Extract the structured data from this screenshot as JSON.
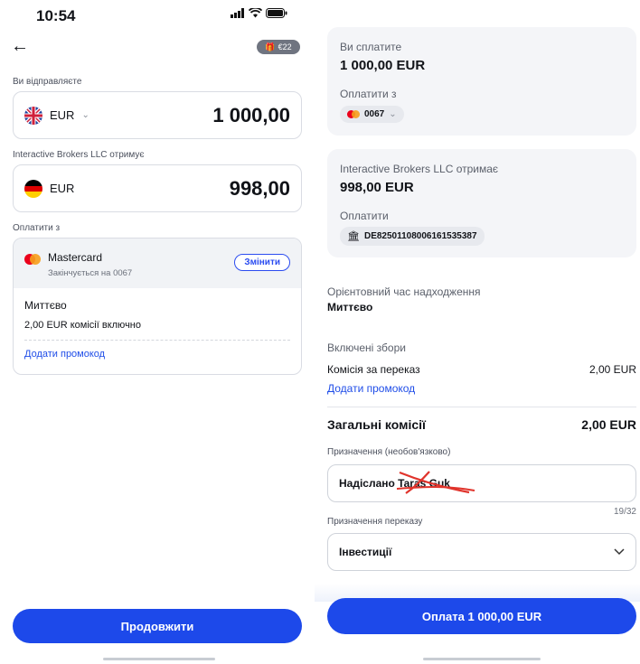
{
  "left": {
    "status_time": "10:54",
    "gift_badge": "€22",
    "send_label": "Ви відправляєте",
    "send_currency": "EUR",
    "send_amount": "1 000,00",
    "recipient_label": "Interactive Brokers LLC отримує",
    "recv_currency": "EUR",
    "recv_amount": "998,00",
    "pay_from_label": "Оплатити з",
    "card_name": "Mastercard",
    "card_ending": "Закінчується на 0067",
    "change_label": "Змінити",
    "speed": "Миттєво",
    "fee_note": "2,00 EUR комісії включно",
    "promo_link": "Додати промокод",
    "continue_label": "Продовжити"
  },
  "right": {
    "you_pay_label": "Ви сплатите",
    "you_pay_value": "1 000,00 EUR",
    "pay_from_label": "Оплатити з",
    "card_chip": "0067",
    "recipient_label": "Interactive Brokers LLC отримає",
    "recipient_value": "998,00 EUR",
    "pay_to_label": "Оплатити",
    "iban_chip": "DE82501108006161535387",
    "eta_label": "Орієнтовний час надходження",
    "eta_value": "Миттєво",
    "fees_included_label": "Включені збори",
    "transfer_fee_label": "Комісія за переказ",
    "transfer_fee_value": "2,00 EUR",
    "promo_link": "Додати промокод",
    "total_fees_label": "Загальні комісії",
    "total_fees_value": "2,00 EUR",
    "reference_label": "Призначення (необов'язково)",
    "reference_value": "Надіслано Taras Guk",
    "reference_counter": "19/32",
    "purpose_label": "Призначення переказу",
    "purpose_value": "Інвестиції",
    "pay_button": "Оплата 1 000,00 EUR"
  },
  "colors": {
    "primary": "#1d49ea",
    "mastercard_red": "#eb001b",
    "mastercard_orange": "#f79e1b",
    "strike_red": "#e0332b"
  }
}
